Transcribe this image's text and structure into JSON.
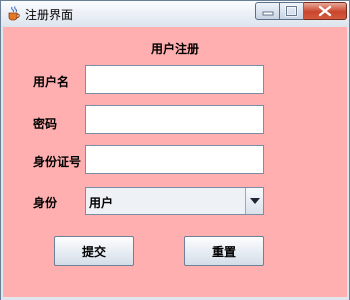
{
  "window": {
    "title": "注册界面"
  },
  "form": {
    "heading": "用户注册",
    "username": {
      "label": "用户名",
      "value": ""
    },
    "password": {
      "label": "密码",
      "value": ""
    },
    "id_number": {
      "label": "身份证号",
      "value": ""
    },
    "identity": {
      "label": "身份",
      "selected": "用户"
    }
  },
  "buttons": {
    "submit": "提交",
    "reset": "重置"
  },
  "colors": {
    "content_background": "#ffafaf",
    "close_button": "#c9462c"
  },
  "icons": {
    "app": "java-coffee-cup-icon",
    "minimize": "minimize-icon",
    "maximize": "maximize-icon",
    "close": "close-icon",
    "dropdown": "chevron-down-icon"
  }
}
